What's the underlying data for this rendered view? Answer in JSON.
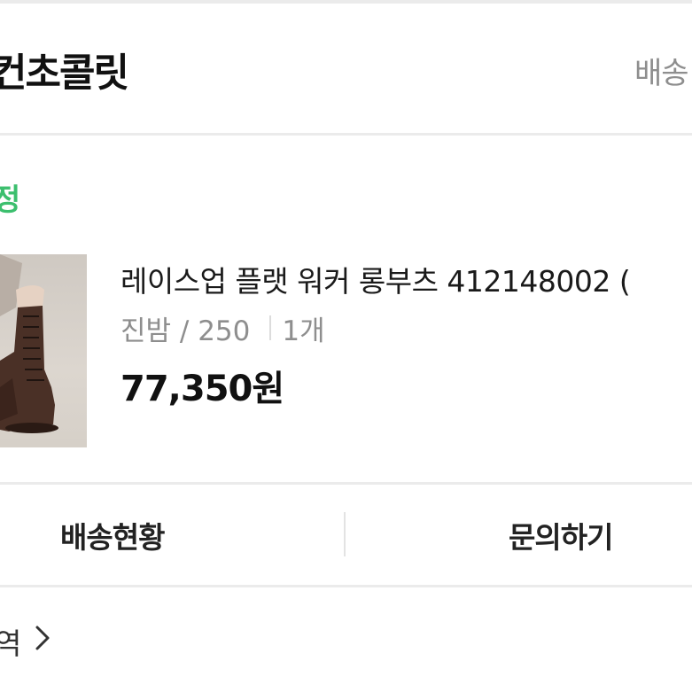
{
  "header": {
    "store_name": "컨초콜릿",
    "store_link_label": "배송"
  },
  "order": {
    "status_label": "정",
    "product_name": "레이스업 플랫 워커 롱부츠 412148002 (",
    "option_text": "진밤 / 250",
    "quantity_text": "1개",
    "price_text": "77,350원"
  },
  "actions": {
    "delivery_status_label": "배송현황",
    "inquiry_label": "문의하기"
  },
  "footer": {
    "history_label": "역"
  },
  "icons": {
    "history_arrow": "chevron-right-icon"
  },
  "colors": {
    "status_green": "#3cbf6e",
    "muted_text": "#8e8e8e"
  }
}
